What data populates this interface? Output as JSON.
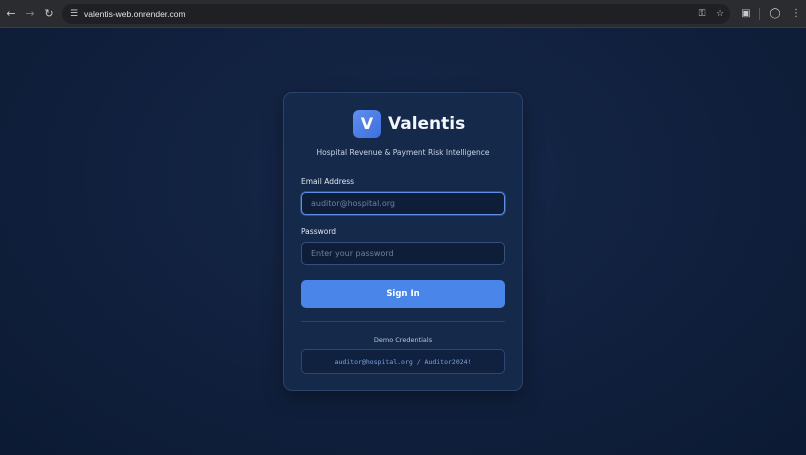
{
  "browser": {
    "url": "valentis-web.onrender.com",
    "icons": {
      "back": "arrow-left-icon",
      "forward": "arrow-right-icon",
      "reload": "reload-icon",
      "site_info": "tune-icon",
      "password": "key-icon",
      "bookmark": "star-icon",
      "cast": "cast-icon",
      "profile": "profile-icon",
      "menu": "kebab-menu-icon"
    }
  },
  "login": {
    "logo_letter": "V",
    "brand": "Valentis",
    "tagline": "Hospital Revenue & Payment Risk Intelligence",
    "email_label": "Email Address",
    "email_placeholder": "auditor@hospital.org",
    "email_value": "",
    "password_label": "Password",
    "password_placeholder": "Enter your password",
    "password_value": "",
    "submit_label": "Sign In",
    "demo_title": "Demo Credentials",
    "demo_credentials": "auditor@hospital.org / Auditor2024!"
  },
  "colors": {
    "accent": "#4a86ea",
    "page_background": "#0f1b33",
    "card_background": "#152a4b"
  }
}
